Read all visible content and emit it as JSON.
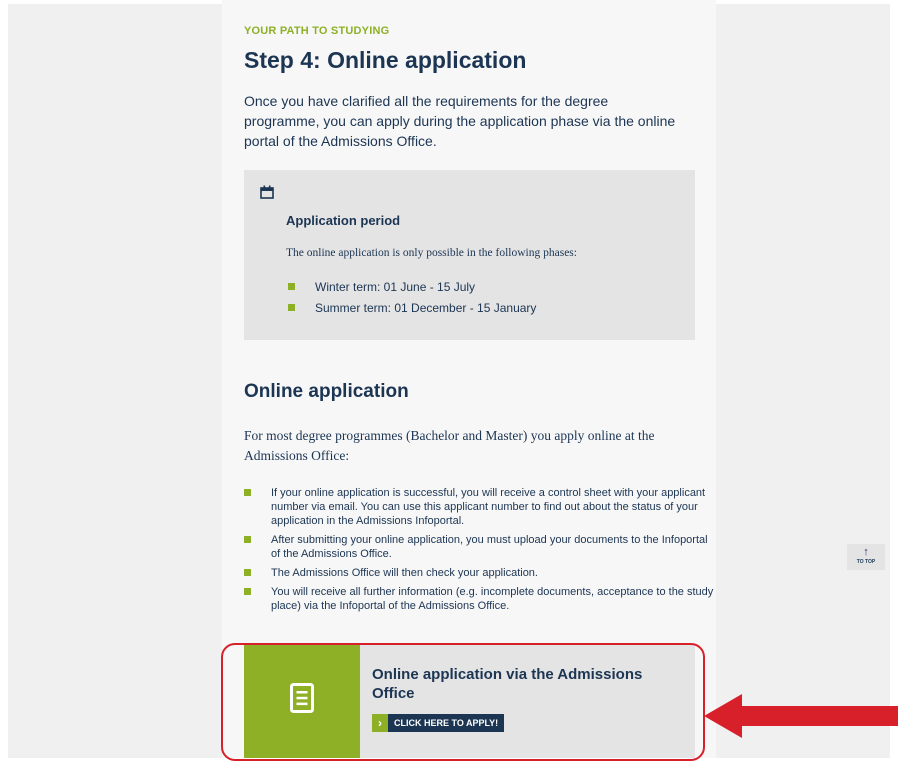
{
  "header": {
    "eyebrow": "YOUR PATH TO STUDYING",
    "title": "Step 4: Online application",
    "intro": "Once you have clarified all the requirements for the degree programme, you can apply during the application phase via the online portal of the Admissions Office."
  },
  "application_period": {
    "icon": "calendar-icon",
    "title": "Application period",
    "text": "The online application is only possible in the following phases:",
    "items": [
      "Winter term: 01 June - 15 July",
      "Summer term: 01 December - 15 January"
    ]
  },
  "online_application": {
    "title": "Online application",
    "paragraph": "For most degree programmes (Bachelor and Master) you apply online at the Admissions Office:",
    "bullets": [
      "If your online application is successful, you will receive a control sheet with your applicant number via email. You can use this applicant number to find out about the status of your application in the Admissions Infoportal.",
      "After submitting your online application, you must upload your documents to the Infoportal of the Admissions Office.",
      "The Admissions Office will then check your application.",
      "You will receive all further information (e.g. incomplete documents, acceptance to the study place) via the Infoportal of the Admissions Office."
    ]
  },
  "apply_card": {
    "icon": "document-icon",
    "title": "Online application via the Admissions Office",
    "button_label": "CLICK HERE TO APPLY!"
  },
  "to_top": {
    "arrow": "↑",
    "label": "TO TOP"
  },
  "colors": {
    "accent_green": "#8db026",
    "navy": "#1c3553",
    "highlight_red": "#d8202a"
  }
}
